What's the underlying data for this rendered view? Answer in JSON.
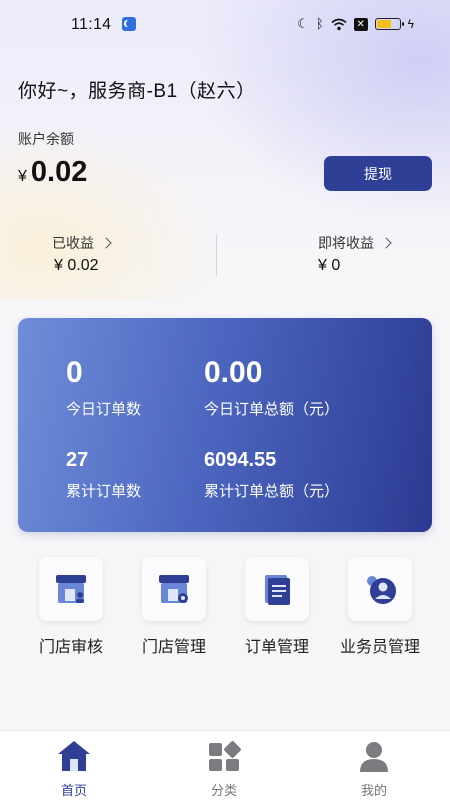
{
  "status_bar": {
    "time": "11:14",
    "icons": [
      "moon-icon",
      "bluetooth-icon",
      "wifi-icon",
      "sim-x-icon",
      "battery-icon",
      "charging-icon"
    ]
  },
  "header": {
    "greeting": "你好~，服务商-B1（赵六）",
    "balance_label": "账户余额",
    "currency": "¥",
    "balance": "0.02",
    "withdraw_label": "提现"
  },
  "earnings": {
    "earned_label": "已收益",
    "earned_value": "¥ 0.02",
    "upcoming_label": "即将收益",
    "upcoming_value": "¥ 0"
  },
  "stats": {
    "today_orders": "0",
    "today_orders_label": "今日订单数",
    "today_amount": "0.00",
    "today_amount_label": "今日订单总额（元）",
    "total_orders": "27",
    "total_orders_label": "累计订单数",
    "total_amount": "6094.55",
    "total_amount_label": "累计订单总额（元）"
  },
  "menu": [
    {
      "label": "门店审核",
      "icon": "store-review-icon"
    },
    {
      "label": "门店管理",
      "icon": "store-manage-icon"
    },
    {
      "label": "订单管理",
      "icon": "document-icon"
    },
    {
      "label": "业务员管理",
      "icon": "salesperson-icon"
    }
  ],
  "tabs": [
    {
      "label": "首页",
      "icon": "home-icon",
      "active": true
    },
    {
      "label": "分类",
      "icon": "category-icon",
      "active": false
    },
    {
      "label": "我的",
      "icon": "person-icon",
      "active": false
    }
  ],
  "colors": {
    "accent": "#2f3f96",
    "card_start": "#6f8dd8",
    "card_end": "#2c3a91"
  }
}
